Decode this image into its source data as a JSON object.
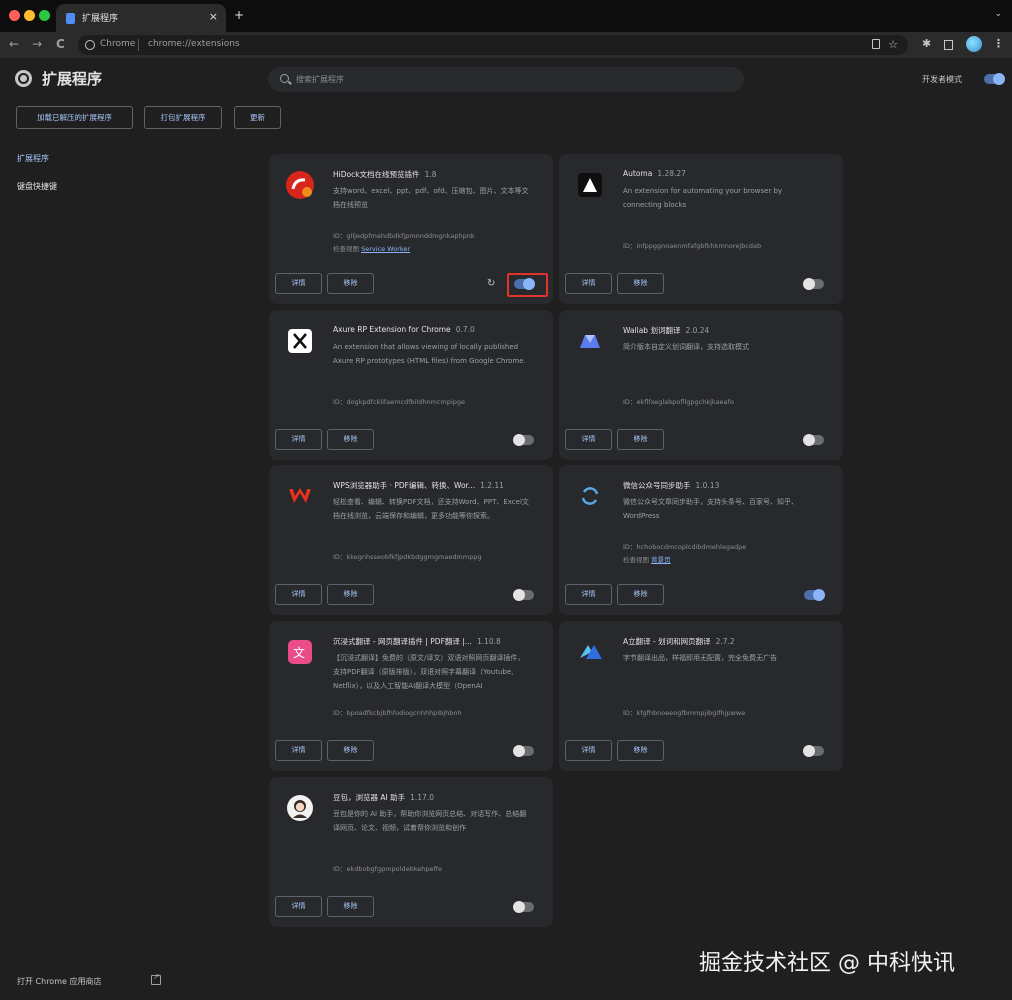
{
  "browser": {
    "tab_title": "扩展程序",
    "tab_close": "×",
    "new_tab": "+",
    "tab_dropdown": "⌄",
    "back": "←",
    "forward": "→",
    "reload": "C",
    "omnibox_scheme": "Chrome",
    "omnibox_url": "chrome://extensions",
    "bookmark": "☆",
    "menu": "⋮"
  },
  "header": {
    "title": "扩展程序",
    "search_placeholder": "搜索扩展程序",
    "dev_mode_label": "开发者模式",
    "dev_mode_on": true
  },
  "actions": {
    "load_unpacked": "加载已解压的扩展程序",
    "pack": "打包扩展程序",
    "update": "更新"
  },
  "sidebar": {
    "items": [
      {
        "label": "扩展程序",
        "active": true
      },
      {
        "label": "键盘快捷键",
        "active": false
      }
    ],
    "webstore_link": "打开 Chrome 应用商店"
  },
  "card_labels": {
    "details": "详情",
    "remove": "移除",
    "id_prefix": "ID：",
    "inspect_prefix": "检查视图",
    "reload": "↻"
  },
  "extensions": [
    {
      "name": "HiDock文档在线预览插件",
      "version": "1.8",
      "description": "支持word、excel、ppt、pdf、ofd、压缩包、图片、文本等文档在线预览",
      "id": "glljedpfmehdbdkfjpmnnddmgnkaphpnk",
      "inspect_view": "Service Worker",
      "enabled": true,
      "highlighted": true,
      "show_reload": true,
      "icon": "hidock-icon",
      "icon_color": "#d9261c"
    },
    {
      "name": "Automa",
      "version": "1.28.27",
      "description": "An extension for automating your browser by connecting blocks",
      "id": "infppggnoaenmfafgbfkhkmnorejbcdab",
      "inspect_view": "",
      "enabled": false,
      "highlighted": false,
      "show_reload": false,
      "icon": "automa-icon",
      "icon_color": "#0f0f0f"
    },
    {
      "name": "Axure RP Extension for Chrome",
      "version": "0.7.0",
      "description": "An extension that allows viewing of locally published Axure RP prototypes (HTML files) from Google Chrome.",
      "id": "dogkpdfcklifaemcdfbildhnmcmpipge",
      "inspect_view": "",
      "enabled": false,
      "highlighted": false,
      "show_reload": false,
      "icon": "axure-icon",
      "icon_color": "#ffffff"
    },
    {
      "name": "Wallab 划词翻译",
      "version": "2.0.24",
      "description": "简介版本自定义划词翻译，支持选取模式",
      "id": "ekflfxeglabpofllgpgchkjkaeafo",
      "inspect_view": "",
      "enabled": false,
      "highlighted": false,
      "show_reload": false,
      "icon": "wallab-icon",
      "icon_color": "#5b7cf0"
    },
    {
      "name": "WPS浏览器助手 · PDF编辑、转换、Wor...",
      "version": "1.2.11",
      "description": "轻松查看、编辑、转换PDF文档，还支持Word、PPT、Excel文档在线浏览，云端保存和编辑，更多功能等你探索。",
      "id": "kkegnhsseobfkfjpdkbdggmgmaedmmppg",
      "inspect_view": "",
      "enabled": false,
      "highlighted": false,
      "show_reload": false,
      "icon": "wps-icon",
      "icon_color": "#e8331c"
    },
    {
      "name": "微信公众号同步助手",
      "version": "1.0.13",
      "description": "微信公众号文章同步助手，支持头条号、百家号、知乎、WordPress",
      "id": "hchobocdmcoplcdibdmehlegadpe",
      "inspect_view": "背景页",
      "enabled": true,
      "highlighted": false,
      "show_reload": false,
      "icon": "sync-icon",
      "icon_color": "#5aa9e6"
    },
    {
      "name": "沉浸式翻译 - 网页翻译插件 | PDF翻译 |...",
      "version": "1.10.8",
      "description": "【沉浸式翻译】免费的（原文/译文）双语对照网页翻译插件，支持PDF翻译（原版排版），双语对照字幕翻译（Youtube, Netflix），以及人工智能AI翻译大模型（OpenAI",
      "id": "bpoadfkcbjbfhfodiogcnhhhpibjhbnh",
      "inspect_view": "",
      "enabled": false,
      "highlighted": false,
      "show_reload": false,
      "icon": "immersive-translate-icon",
      "icon_color": "#ea4c89"
    },
    {
      "name": "A立翻译 - 划词和网页翻译",
      "version": "2.7.2",
      "description": "字节翻译出品，样福即用无配置，完全免费无广告",
      "id": "kfgfhbnoeeogfbmmpjibglfhjpwwe",
      "inspect_view": "",
      "enabled": false,
      "highlighted": false,
      "show_reload": false,
      "icon": "translate-a-icon",
      "icon_color": "#2f6de1"
    },
    {
      "name": "豆包，浏览器 AI 助手",
      "version": "1.17.0",
      "description": "豆包是你的 AI 助手，帮助你浏览网页总结、对话写作、总结翻译网页、论文、视频，试着帮你浏览和创作",
      "id": "ekdbobgfgpmpoldebkehpeffe",
      "inspect_view": "",
      "enabled": false,
      "highlighted": false,
      "show_reload": false,
      "icon": "doubao-icon",
      "icon_color": "#f2f2f2"
    }
  ],
  "watermark": "掘金技术社区 @ 中科快讯"
}
